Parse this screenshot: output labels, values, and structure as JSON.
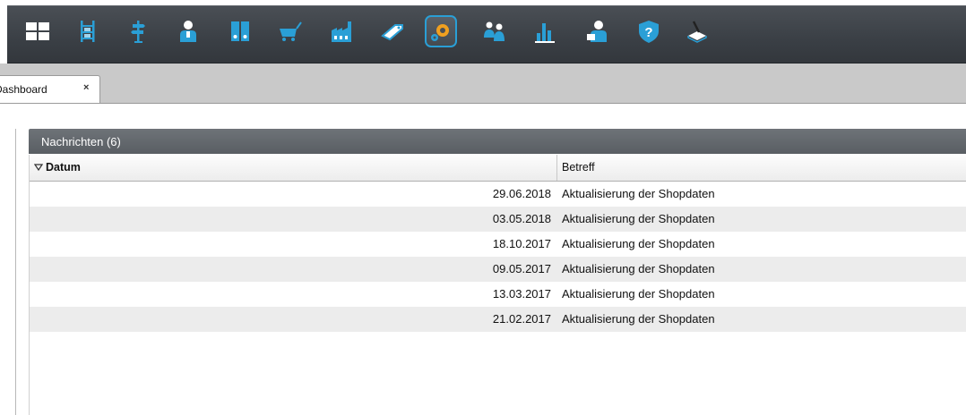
{
  "toolbar": {
    "items": [
      {
        "icon": "dashboard-grid-icon"
      },
      {
        "icon": "warehouse-shelf-icon"
      },
      {
        "icon": "signpost-icon"
      },
      {
        "icon": "customer-person-icon"
      },
      {
        "icon": "binders-icon"
      },
      {
        "icon": "shopping-cart-icon"
      },
      {
        "icon": "factory-icon"
      },
      {
        "icon": "label-tag-icon"
      },
      {
        "icon": "settings-gears-icon",
        "active": true
      },
      {
        "icon": "users-group-icon"
      },
      {
        "icon": "bar-chart-icon"
      },
      {
        "icon": "user-admin-icon"
      },
      {
        "icon": "help-shield-icon"
      },
      {
        "icon": "pen-plotter-icon"
      }
    ],
    "colors": {
      "accent": "#2a9fd6",
      "icon_blue": "#2a9fd6",
      "background": "#3f444a"
    }
  },
  "tabs": [
    {
      "label": "Dashboard",
      "close": "×"
    }
  ],
  "panel": {
    "title": "Nachrichten (6)",
    "columns": {
      "datum": "Datum",
      "betreff": "Betreff"
    },
    "sort_icon": "sort-desc-icon",
    "rows": [
      {
        "datum": "29.06.2018",
        "betreff": "Aktualisierung der Shopdaten"
      },
      {
        "datum": "03.05.2018",
        "betreff": "Aktualisierung der Shopdaten"
      },
      {
        "datum": "18.10.2017",
        "betreff": "Aktualisierung der Shopdaten"
      },
      {
        "datum": "09.05.2017",
        "betreff": "Aktualisierung der Shopdaten"
      },
      {
        "datum": "13.03.2017",
        "betreff": "Aktualisierung der Shopdaten"
      },
      {
        "datum": "21.02.2017",
        "betreff": "Aktualisierung der Shopdaten"
      }
    ]
  }
}
